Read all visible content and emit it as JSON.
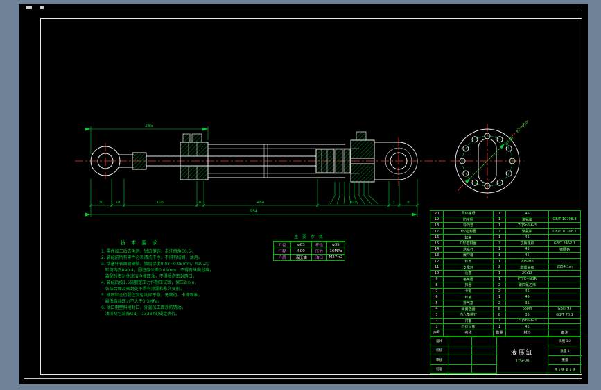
{
  "colors": {
    "background": "#6e8196",
    "sheet": "#000000",
    "line_white": "#e8e8e8",
    "line_green": "#00cc33",
    "line_red": "#ff3333",
    "magenta": "#e070e0"
  },
  "drawing": {
    "dims": {
      "top": "285",
      "seg": [
        "30",
        "18",
        "105",
        "10",
        "464",
        "103",
        "3",
        "8"
      ],
      "total": "954"
    },
    "flange": {
      "holes_note": "12×φ18",
      "diameter_note": "φ190"
    }
  },
  "notes": {
    "title": "技 术 要 求",
    "lines": [
      "1. 零件加工后去毛刺，锐边倒钝，未注倒角C0.5。",
      "2. 装配前所有零件必须清洗干净，不得有切屑、油污。",
      "3. 活塞杆表面镀硬铬，镀层厚度0.03~0.05mm，Ra0.2；",
      "   缸筒内孔Ra0.4，圆柱度公差0.03mm，不得有纵向划痕，",
      "   装配时密封件涂洁净液压油，不得损伤密封唇口。",
      "4. 装配后按1.5倍额定压力作耐压试验，保压2min，",
      "   各结合面及密封处不得有渗漏和永久变形。",
      "5. 液压缸全行程往复运动应平稳，无爬行、卡滞现象，",
      "   最低启动压力不大于0.3MPa。",
      "6. 油口用塑料堵封口，外露加工面涂防锈油，",
      "   油漆及包装按GB/T 13384的规定执行。"
    ]
  },
  "params": {
    "title": "主 要 参 数",
    "rows": [
      {
        "l1": "缸径",
        "v1": "φ63",
        "l2": "杆径",
        "v2": "φ35"
      },
      {
        "l1": "行程",
        "v1": "500",
        "l2": "压力",
        "v2": "16MPa"
      },
      {
        "l1": "介质",
        "v1": "液压油",
        "l2": "油口",
        "v2": "M27×2"
      }
    ]
  },
  "bom": {
    "header": [
      "序号",
      "名称",
      "数量",
      "材料",
      "备注"
    ],
    "rows": [
      {
        "no": "20",
        "name": "耳环螺母",
        "qty": "1",
        "mat": "45",
        "note": ""
      },
      {
        "no": "19",
        "name": "防尘圈",
        "qty": "1",
        "mat": "聚氨酯",
        "note": "GB/T 10708.3"
      },
      {
        "no": "18",
        "name": "导向套",
        "qty": "1",
        "mat": "ZQSn6-6-3",
        "note": ""
      },
      {
        "no": "17",
        "name": "Y形密封圈",
        "qty": "2",
        "mat": "聚氨酯",
        "note": "GB/T 10708.1"
      },
      {
        "no": "16",
        "name": "缸盖",
        "qty": "1",
        "mat": "45",
        "note": ""
      },
      {
        "no": "15",
        "name": "O形密封圈",
        "qty": "2",
        "mat": "丁腈橡胶",
        "note": "GB/T 3452.1"
      },
      {
        "no": "14",
        "name": "活塞杆",
        "qty": "1",
        "mat": "45",
        "note": "镀硬铬"
      },
      {
        "no": "13",
        "name": "缓冲套",
        "qty": "1",
        "mat": "45",
        "note": ""
      },
      {
        "no": "12",
        "name": "缸筒",
        "qty": "1",
        "mat": "27SiMn",
        "note": ""
      },
      {
        "no": "11",
        "name": "支承环",
        "qty": "2",
        "mat": "酚醛夹布",
        "note": "2154:1m"
      },
      {
        "no": "10",
        "name": "活塞",
        "qty": "1",
        "mat": "2Cr13",
        "note": ""
      },
      {
        "no": "9",
        "name": "格莱圈",
        "qty": "1",
        "mat": "PTFE+NBR",
        "note": ""
      },
      {
        "no": "8",
        "name": "挡圈",
        "qty": "2",
        "mat": "聚四氟乙烯",
        "note": ""
      },
      {
        "no": "7",
        "name": "卡键",
        "qty": "2",
        "mat": "45",
        "note": ""
      },
      {
        "no": "6",
        "name": "缸底",
        "qty": "1",
        "mat": "45",
        "note": ""
      },
      {
        "no": "5",
        "name": "排气塞",
        "qty": "2",
        "mat": "35",
        "note": ""
      },
      {
        "no": "4",
        "name": "弹簧垫圈",
        "qty": "8",
        "mat": "65Mn",
        "note": "GB/T 93"
      },
      {
        "no": "3",
        "name": "内六角螺钉",
        "qty": "8",
        "mat": "35",
        "note": "GB/T 70.1"
      },
      {
        "no": "2",
        "name": "衬套",
        "qty": "2",
        "mat": "ZQSn6-6-3",
        "note": ""
      },
      {
        "no": "1",
        "name": "缸体耳环",
        "qty": "1",
        "mat": "45",
        "note": ""
      }
    ]
  },
  "title_block": {
    "sig_rows": [
      "设计",
      "校核",
      "审核",
      "批准"
    ],
    "name": "液压缸",
    "dwg_no": "YYG-00",
    "right_rows": [
      "比例  1:2",
      "数量  1",
      "重量",
      "共 1 张  第 1 张"
    ]
  }
}
